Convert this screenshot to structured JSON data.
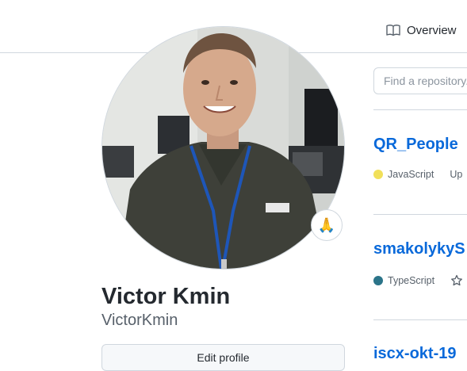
{
  "header": {
    "tabs": [
      {
        "label": "Overview",
        "icon": "book-icon"
      }
    ]
  },
  "profile": {
    "full_name": "Victor Kmin",
    "username": "VictorKmin",
    "status_emoji": "🙏",
    "edit_button_label": "Edit profile"
  },
  "repos": {
    "search_placeholder": "Find a repository...",
    "items": [
      {
        "name": "QR_People",
        "language": "JavaScript",
        "language_color": "#f1e05a",
        "extra": "Up"
      },
      {
        "name": "smakolykyS",
        "language": "TypeScript",
        "language_color": "#3178c6",
        "extra": ""
      },
      {
        "name": "iscx-okt-19",
        "language": "",
        "language_color": "",
        "extra": ""
      }
    ]
  }
}
